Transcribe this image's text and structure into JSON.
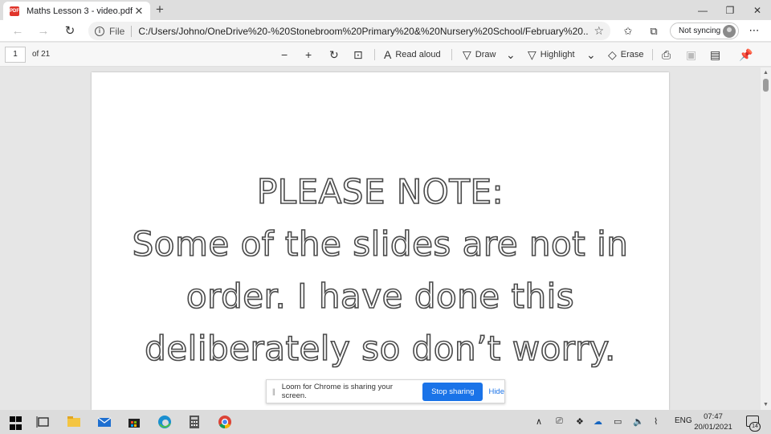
{
  "browser": {
    "tab_title": "Maths Lesson 3 - video.pdf",
    "tab_icon": "pdf-icon",
    "tab_close": "✕",
    "new_tab": "+",
    "window_controls": [
      "—",
      "❐",
      "✕"
    ],
    "url_scheme": "File",
    "url": "C:/Users/Johno/OneDrive%20-%20Stonebroom%20Primary%20&%20Nursery%20School/February%20...",
    "sync_label": "Not syncing"
  },
  "pdf_toolbar": {
    "page_number": "1",
    "page_total": "of 21",
    "read_aloud": "Read aloud",
    "draw": "Draw",
    "highlight": "Highlight",
    "erase": "Erase"
  },
  "document": {
    "lines": [
      "PLEASE NOTE:",
      "Some of the slides are not in",
      "order. I have done this",
      "deliberately so don’t worry."
    ]
  },
  "loom_banner": {
    "grip": "||",
    "message": "Loom for Chrome is sharing your screen.",
    "stop_label": "Stop sharing",
    "hide_label": "Hide"
  },
  "taskbar": {
    "language": "ENG",
    "time": "07:47",
    "date": "20/01/2021",
    "notification_count": "14"
  },
  "colors": {
    "accent_blue": "#1a73e8",
    "pdf_red": "#e0352b",
    "page_bg": "#ffffff"
  }
}
